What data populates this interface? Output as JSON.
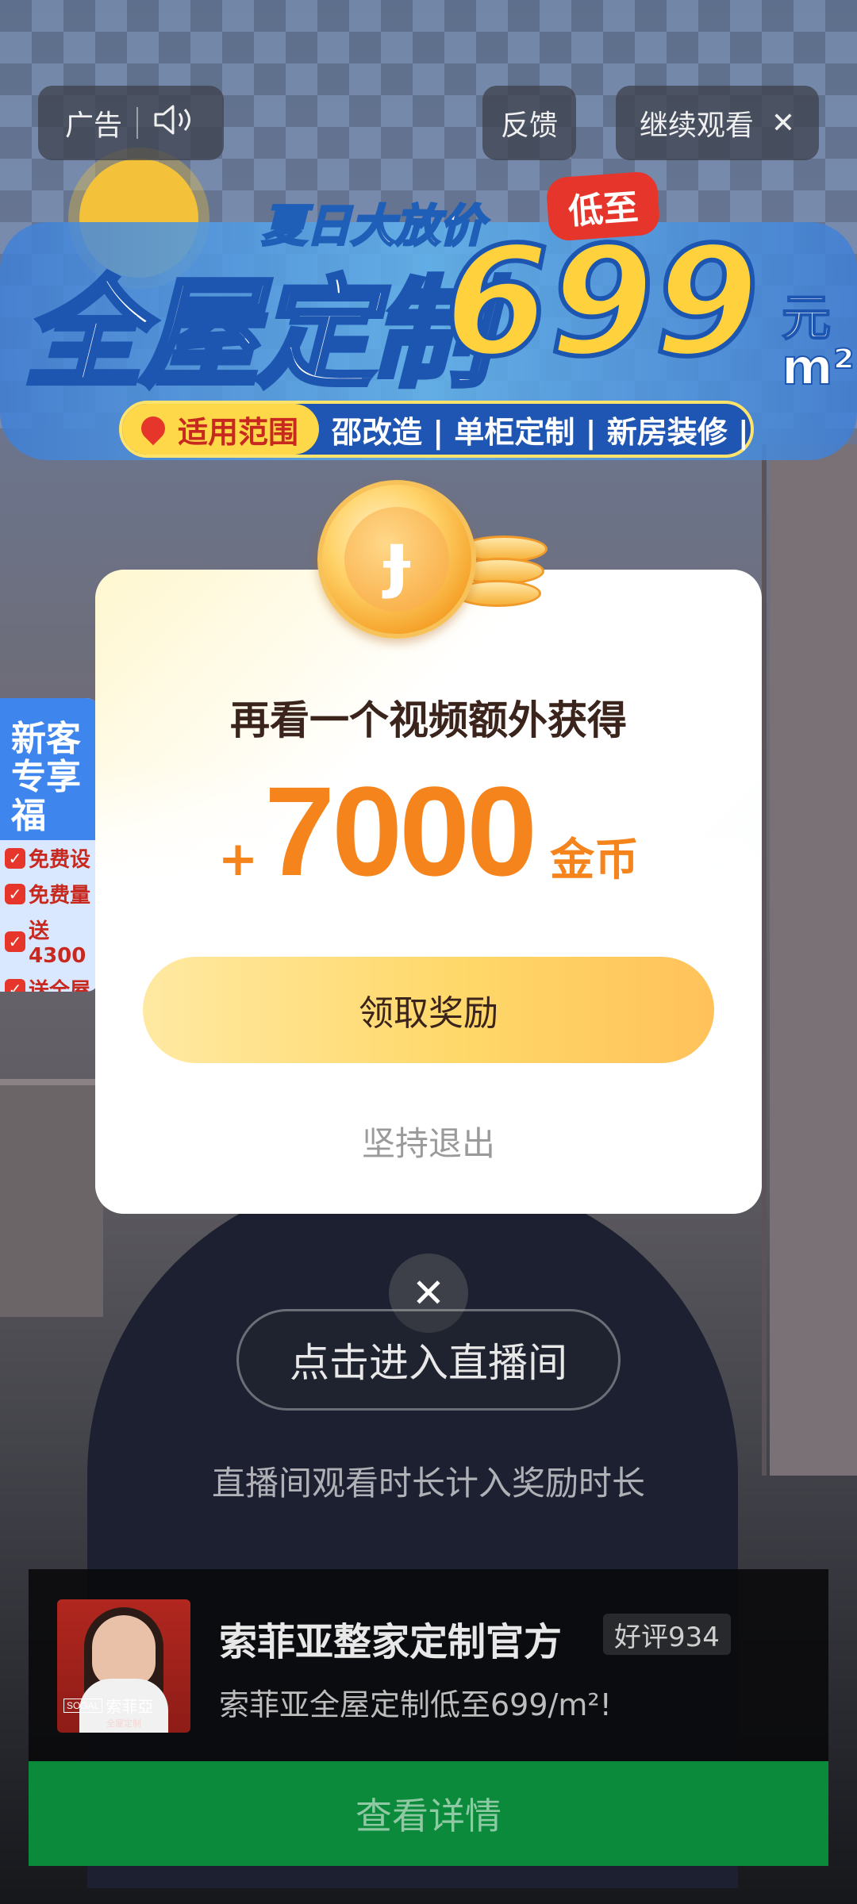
{
  "topbar": {
    "ad_label": "广告",
    "sound_icon": "speaker-icon",
    "feedback_label": "反馈",
    "continue_label": "继续观看",
    "close_icon": "close-icon"
  },
  "banner": {
    "subtitle": "夏日大放价",
    "tag": "低至",
    "title": "全屋定制",
    "price": "699",
    "unit_top": "元",
    "unit_bottom": "m²",
    "scope_label": "适用范围",
    "scope_text": "邵改造 | 单柜定制 | 新房装修 |"
  },
  "promo": {
    "head_1": "新客",
    "head_2": "专享福",
    "rows": [
      "免费设",
      "免费量",
      "送4300",
      "送全屋"
    ]
  },
  "dialog": {
    "title": "再看一个视频额外获得",
    "plus": "+",
    "amount": "7000",
    "unit": "金币",
    "claim_button": "领取奖励",
    "quit_link": "坚持退出"
  },
  "live": {
    "enter_button": "点击进入直播间",
    "note": "直播间观看时长计入奖励时长"
  },
  "advertiser": {
    "name": "索菲亚整家定制官方",
    "rating": "好评934",
    "description": "索菲亚全屋定制低至699/m²!",
    "logo_brand_latin": "SOGAL",
    "logo_brand_cn": "索菲亞",
    "logo_brand_sub": "全屋定制",
    "detail_button": "查看详情"
  },
  "colors": {
    "accent_orange": "#f5841d",
    "claim_button": "#ffd86a",
    "detail_button": "#0a8a3a"
  }
}
